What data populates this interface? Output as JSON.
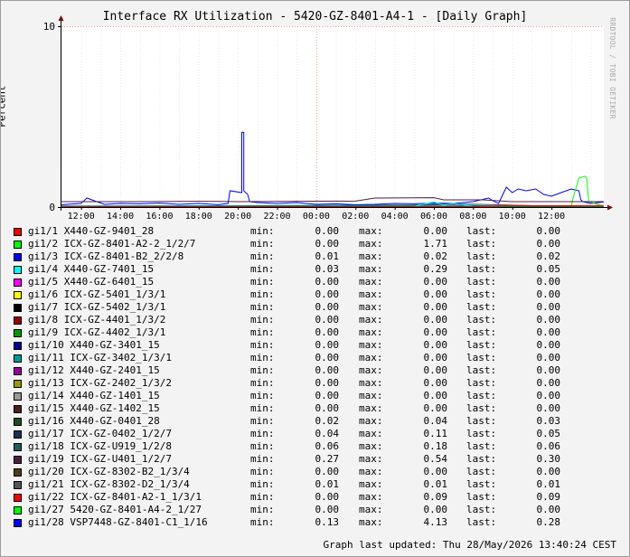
{
  "title": "Interface RX Utilization - 5420-GZ-8401-A4-1 - [Daily Graph]",
  "watermark": "RRDTOOL / TOBI OETIKER",
  "footer": "Graph last updated: Thu 28/May/2026 13:40:24 CEST",
  "chart_data": {
    "type": "line",
    "title": "Interface RX Utilization - 5420-GZ-8401-A4-1 - [Daily Graph]",
    "ylabel": "Percent",
    "ylim": [
      0,
      10
    ],
    "yticks": [
      "0",
      "10"
    ],
    "x_ticks": [
      "12:00",
      "14:00",
      "16:00",
      "18:00",
      "20:00",
      "22:00",
      "00:00",
      "02:00",
      "04:00",
      "06:00",
      "08:00",
      "10:00",
      "12:00"
    ],
    "x_unit": "hours since 11:00 (day 1)",
    "xlim": [
      0,
      27.67
    ],
    "grid": true,
    "series": [
      {
        "name": "gi1/28 VSP7448-GZ-8401-C1_1/16",
        "color": "#0000ff",
        "points": [
          [
            0,
            0.13
          ],
          [
            1,
            0.2
          ],
          [
            1.3,
            0.5
          ],
          [
            1.8,
            0.3
          ],
          [
            2.2,
            0.15
          ],
          [
            3,
            0.2
          ],
          [
            4,
            0.18
          ],
          [
            5,
            0.22
          ],
          [
            6,
            0.15
          ],
          [
            7,
            0.2
          ],
          [
            8,
            0.13
          ],
          [
            8.5,
            0.2
          ],
          [
            8.6,
            0.9
          ],
          [
            9.2,
            0.8
          ],
          [
            9.2,
            4.13
          ],
          [
            9.3,
            4.13
          ],
          [
            9.3,
            0.9
          ],
          [
            9.5,
            0.7
          ],
          [
            9.6,
            0.3
          ],
          [
            10,
            0.25
          ],
          [
            11,
            0.2
          ],
          [
            12,
            0.25
          ],
          [
            13,
            0.15
          ],
          [
            14,
            0.18
          ],
          [
            15,
            0.13
          ],
          [
            16,
            0.15
          ],
          [
            17,
            0.2
          ],
          [
            18,
            0.18
          ],
          [
            19,
            0.22
          ],
          [
            20,
            0.2
          ],
          [
            21,
            0.3
          ],
          [
            21.8,
            0.5
          ],
          [
            22,
            0.35
          ],
          [
            22.3,
            0.2
          ],
          [
            22.7,
            1.1
          ],
          [
            23,
            0.8
          ],
          [
            23.3,
            1.0
          ],
          [
            23.7,
            0.9
          ],
          [
            24.2,
            1.0
          ],
          [
            24.6,
            0.7
          ],
          [
            25,
            0.6
          ],
          [
            25.5,
            0.8
          ],
          [
            26,
            1.0
          ],
          [
            26.4,
            0.9
          ],
          [
            26.5,
            0.4
          ],
          [
            26.6,
            0.3
          ],
          [
            27,
            0.2
          ],
          [
            27.67,
            0.28
          ]
        ]
      },
      {
        "name": "gi1/2 ICX-GZ-8401-A2-2_1/2/7",
        "color": "#00ff00",
        "points": [
          [
            0,
            0
          ],
          [
            26,
            0
          ],
          [
            26.1,
            0.5
          ],
          [
            26.4,
            1.6
          ],
          [
            26.7,
            1.71
          ],
          [
            26.8,
            1.6
          ],
          [
            26.9,
            0.3
          ],
          [
            27.67,
            0.05
          ]
        ]
      },
      {
        "name": "gi1/19 ICX-GZ-U401_1/2/7",
        "color": "#4d1f3d",
        "points": [
          [
            0,
            0.3
          ],
          [
            4,
            0.3
          ],
          [
            7,
            0.32
          ],
          [
            9,
            0.3
          ],
          [
            12,
            0.32
          ],
          [
            15,
            0.33
          ],
          [
            16,
            0.5
          ],
          [
            19,
            0.52
          ],
          [
            19.5,
            0.4
          ],
          [
            21.5,
            0.4
          ],
          [
            23,
            0.3
          ],
          [
            24.5,
            0.3
          ],
          [
            27.67,
            0.3
          ]
        ]
      },
      {
        "name": "gi1/17 ICX-GZ-0402_1/2/7",
        "color": "#1f2f55",
        "points": [
          [
            0,
            0.05
          ],
          [
            10,
            0.06
          ],
          [
            15,
            0.08
          ],
          [
            20,
            0.11
          ],
          [
            22,
            0.06
          ],
          [
            27.67,
            0.05
          ]
        ]
      },
      {
        "name": "gi1/18 ICX-GZ-U919_1/2/8",
        "color": "#1f5c5c",
        "points": [
          [
            0,
            0.06
          ],
          [
            10,
            0.08
          ],
          [
            18,
            0.12
          ],
          [
            20,
            0.18
          ],
          [
            24,
            0.08
          ],
          [
            27.67,
            0.06
          ]
        ]
      },
      {
        "name": "gi1/4 X440-GZ-7401_15",
        "color": "#00ffff",
        "points": [
          [
            0,
            0.03
          ],
          [
            18,
            0.05
          ],
          [
            19,
            0.29
          ],
          [
            19.5,
            0.1
          ],
          [
            20,
            0.2
          ],
          [
            21,
            0.05
          ],
          [
            27.67,
            0.05
          ]
        ]
      },
      {
        "name": "gi1/16 X440-GZ-0401_28",
        "color": "#1f4d1f",
        "points": [
          [
            0,
            0.02
          ],
          [
            12,
            0.03
          ],
          [
            20,
            0.04
          ],
          [
            27.67,
            0.03
          ]
        ]
      },
      {
        "name": "gi1/22 ICX-GZ-8401-A2-1_1/3/1",
        "color": "#ff0000",
        "points": [
          [
            0,
            0
          ],
          [
            21,
            0
          ],
          [
            22,
            0.05
          ],
          [
            23,
            0.09
          ],
          [
            24,
            0.06
          ],
          [
            27.67,
            0.09
          ]
        ]
      }
    ]
  },
  "legend_labels": {
    "min": "min:",
    "max": "max:",
    "last": "last:"
  },
  "legend": [
    {
      "color": "#ff0000",
      "label": "gi1/1 X440-GZ-9401_28",
      "min": "0.00",
      "max": "0.00",
      "last": "0.00"
    },
    {
      "color": "#00ff00",
      "label": "gi1/2 ICX-GZ-8401-A2-2_1/2/7",
      "min": "0.00",
      "max": "1.71",
      "last": "0.00"
    },
    {
      "color": "#0000ff",
      "label": "gi1/3 ICX-GZ-8401-B2_2/2/8",
      "min": "0.01",
      "max": "0.02",
      "last": "0.02"
    },
    {
      "color": "#00ffff",
      "label": "gi1/4 X440-GZ-7401_15",
      "min": "0.03",
      "max": "0.29",
      "last": "0.05"
    },
    {
      "color": "#ff00ff",
      "label": "gi1/5 X440-GZ-6401_15",
      "min": "0.00",
      "max": "0.00",
      "last": "0.00"
    },
    {
      "color": "#ffff00",
      "label": "gi1/6 ICX-GZ-5401_1/3/1",
      "min": "0.00",
      "max": "0.00",
      "last": "0.00"
    },
    {
      "color": "#000000",
      "label": "gi1/7 ICX-GZ-5402_1/3/1",
      "min": "0.00",
      "max": "0.00",
      "last": "0.00"
    },
    {
      "color": "#990000",
      "label": "gi1/8 ICX-GZ-4401_1/3/2",
      "min": "0.00",
      "max": "0.00",
      "last": "0.00"
    },
    {
      "color": "#009900",
      "label": "gi1/9 ICX-GZ-4402_1/3/1",
      "min": "0.00",
      "max": "0.00",
      "last": "0.00"
    },
    {
      "color": "#000099",
      "label": "gi1/10 X440-GZ-3401_15",
      "min": "0.00",
      "max": "0.00",
      "last": "0.00"
    },
    {
      "color": "#009999",
      "label": "gi1/11 ICX-GZ-3402_1/3/1",
      "min": "0.00",
      "max": "0.00",
      "last": "0.00"
    },
    {
      "color": "#990099",
      "label": "gi1/12 X440-GZ-2401_15",
      "min": "0.00",
      "max": "0.00",
      "last": "0.00"
    },
    {
      "color": "#999900",
      "label": "gi1/13 ICX-GZ-2402_1/3/2",
      "min": "0.00",
      "max": "0.00",
      "last": "0.00"
    },
    {
      "color": "#999999",
      "label": "gi1/14 X440-GZ-1401_15",
      "min": "0.00",
      "max": "0.00",
      "last": "0.00"
    },
    {
      "color": "#4d1f1f",
      "label": "gi1/15 X440-GZ-1402_15",
      "min": "0.00",
      "max": "0.00",
      "last": "0.00"
    },
    {
      "color": "#1f4d1f",
      "label": "gi1/16 X440-GZ-0401_28",
      "min": "0.02",
      "max": "0.04",
      "last": "0.03"
    },
    {
      "color": "#1f2f55",
      "label": "gi1/17 ICX-GZ-0402_1/2/7",
      "min": "0.04",
      "max": "0.11",
      "last": "0.05"
    },
    {
      "color": "#1f5c5c",
      "label": "gi1/18 ICX-GZ-U919_1/2/8",
      "min": "0.06",
      "max": "0.18",
      "last": "0.06"
    },
    {
      "color": "#4d1f3d",
      "label": "gi1/19 ICX-GZ-U401_1/2/7",
      "min": "0.27",
      "max": "0.54",
      "last": "0.30"
    },
    {
      "color": "#4d3d1f",
      "label": "gi1/20 ICX-GZ-8302-B2_1/3/4",
      "min": "0.00",
      "max": "0.00",
      "last": "0.00"
    },
    {
      "color": "#555555",
      "label": "gi1/21 ICX-GZ-8302-D2_1/3/4",
      "min": "0.01",
      "max": "0.01",
      "last": "0.01"
    },
    {
      "color": "#ff0000",
      "label": "gi1/22 ICX-GZ-8401-A2-1_1/3/1",
      "min": "0.00",
      "max": "0.09",
      "last": "0.09"
    },
    {
      "color": "#00ff00",
      "label": "gi1/27 5420-GZ-8401-A4-2_1/27",
      "min": "0.00",
      "max": "0.00",
      "last": "0.00"
    },
    {
      "color": "#0000ff",
      "label": "gi1/28 VSP7448-GZ-8401-C1_1/16",
      "min": "0.13",
      "max": "4.13",
      "last": "0.28"
    }
  ]
}
